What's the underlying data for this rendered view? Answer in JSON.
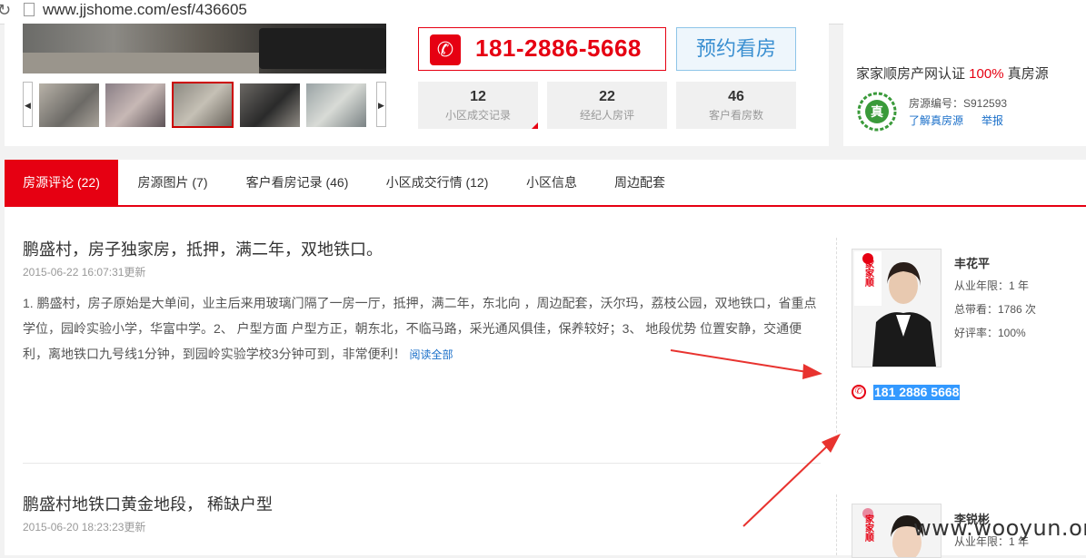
{
  "browser": {
    "url": "www.jjshome.com/esf/436605"
  },
  "gallery": {
    "prev": "◀",
    "next": "▶",
    "thumbs": [
      "living-room",
      "bedroom",
      "kitchen-sink",
      "kitchen-stove",
      "bathroom"
    ]
  },
  "contact": {
    "phone": "181-2886-5668",
    "book_label": "预约看房"
  },
  "stats": [
    {
      "num": "12",
      "label": "小区成交记录"
    },
    {
      "num": "22",
      "label": "经纪人房评"
    },
    {
      "num": "46",
      "label": "客户看房数"
    }
  ],
  "cert": {
    "prefix": "家家顺房产网认证 ",
    "percent": "100%",
    "suffix": " 真房源",
    "badge_char": "真",
    "listing_id": "房源编号：S912593",
    "learn_link": "了解真房源",
    "report_link": "举报"
  },
  "tabs": [
    {
      "label": "房源评论 (22)",
      "active": true
    },
    {
      "label": "房源图片 (7)"
    },
    {
      "label": "客户看房记录 (46)"
    },
    {
      "label": "小区成交行情 (12)"
    },
    {
      "label": "小区信息"
    },
    {
      "label": "周边配套"
    }
  ],
  "reviews": [
    {
      "title": "鹏盛村，房子独家房，抵押，满二年，双地铁口。",
      "date": "2015-06-22 16:07:31更新",
      "body": "1. 鹏盛村，房子原始是大单间，业主后来用玻璃门隔了一房一厅，抵押，满二年，东北向 ，周边配套，沃尔玛，荔枝公园，双地铁口，省重点学位，园岭实验小学，华富中学。2、 户型方面 户型方正，朝东北，不临马路，采光通风俱佳，保养较好；3、 地段优势 位置安静，交通便利，离地铁口九号线1分钟，到园岭实验学校3分钟可到，非常便利！",
      "more": "阅读全部",
      "agent": {
        "name": "丰花平",
        "years": "从业年限：1 年",
        "total": "总带看：1786 次",
        "rating": "好评率：100%",
        "phone": "181 2886 5668",
        "logo": "家家顺"
      }
    },
    {
      "title": "鹏盛村地铁口黄金地段， 稀缺户型",
      "date": "2015-06-20 18:23:23更新",
      "agent": {
        "name": "李锐彬",
        "years": "从业年限：1 年",
        "logo": "家家顺"
      }
    }
  ],
  "watermark": "www.wooyun.org",
  "colors": {
    "brand_red": "#e60012",
    "link_blue": "#1a6fc9",
    "selection_blue": "#3399ff"
  }
}
